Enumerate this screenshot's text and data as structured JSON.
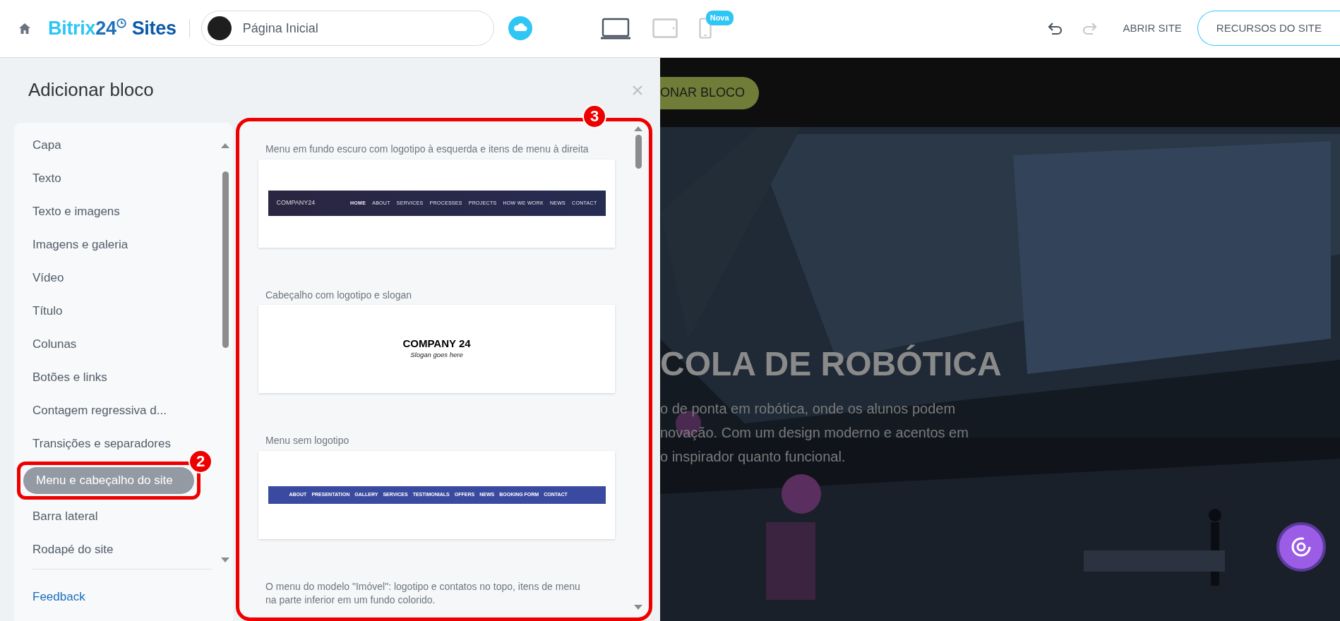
{
  "topbar": {
    "logo_text": "Bitrix24",
    "logo_suffix": "Sites",
    "page_field": {
      "value": "Página Inicial"
    },
    "devices": [
      {
        "kind": "laptop",
        "selected": true
      },
      {
        "kind": "tablet",
        "selected": false
      },
      {
        "kind": "phone",
        "selected": false,
        "badge": "Nova"
      }
    ],
    "undo": {
      "disabled": false
    },
    "redo": {
      "disabled": true
    },
    "open_link": "ABRIR SITE",
    "resources_button": "RECURSOS DO SITE"
  },
  "panel": {
    "title": "Adicionar bloco",
    "categories": [
      {
        "label": "Capa",
        "selected": false
      },
      {
        "label": "Texto",
        "selected": false
      },
      {
        "label": "Texto e imagens",
        "selected": false
      },
      {
        "label": "Imagens e galeria",
        "selected": false
      },
      {
        "label": "Vídeo",
        "selected": false
      },
      {
        "label": "Título",
        "selected": false
      },
      {
        "label": "Colunas",
        "selected": false
      },
      {
        "label": "Botões e links",
        "selected": false
      },
      {
        "label": "Contagem regressiva d...",
        "selected": false
      },
      {
        "label": "Transições e separadores",
        "selected": false
      },
      {
        "label": "Menu e cabeçalho do site",
        "selected": true,
        "callout": "2"
      },
      {
        "label": "Barra lateral",
        "selected": false
      },
      {
        "label": "Rodapé do site",
        "selected": false
      }
    ],
    "feedback": "Feedback",
    "blocks_callout": "3",
    "blocks": [
      {
        "caption": "Menu em fundo escuro com logotipo à esquerda e itens de menu à direita",
        "preview": {
          "kind": "dark-menu",
          "logo": "COMPANY24",
          "items": [
            "HOME",
            "ABOUT",
            "SERVICES",
            "PROCESSES",
            "PROJECTS",
            "HOW WE WORK",
            "NEWS",
            "CONTACT"
          ]
        }
      },
      {
        "caption": "Cabeçalho com logotipo e slogan",
        "preview": {
          "kind": "logo-slogan",
          "logo": "COMPANY 24",
          "slogan": "Slogan goes here"
        }
      },
      {
        "caption": "Menu sem logotipo",
        "preview": {
          "kind": "plain-menu",
          "items": [
            "ABOUT",
            "PRESENTATION",
            "GALLERY",
            "SERVICES",
            "TESTIMONIALS",
            "OFFERS",
            "NEWS",
            "BOOKING FORM",
            "CONTACT"
          ]
        }
      },
      {
        "caption": "O menu do modelo \"Imóvel\": logotipo e contatos no topo, itens de menu na parte inferior em um fundo colorido."
      }
    ]
  },
  "preview": {
    "button": "ONAR BLOCO",
    "title": "COLA DE ROBÓTICA",
    "lines": [
      "o de ponta em robótica, onde os alunos podem",
      "novação. Com um design moderno e acentos em",
      "o inspirador quanto funcional."
    ]
  }
}
